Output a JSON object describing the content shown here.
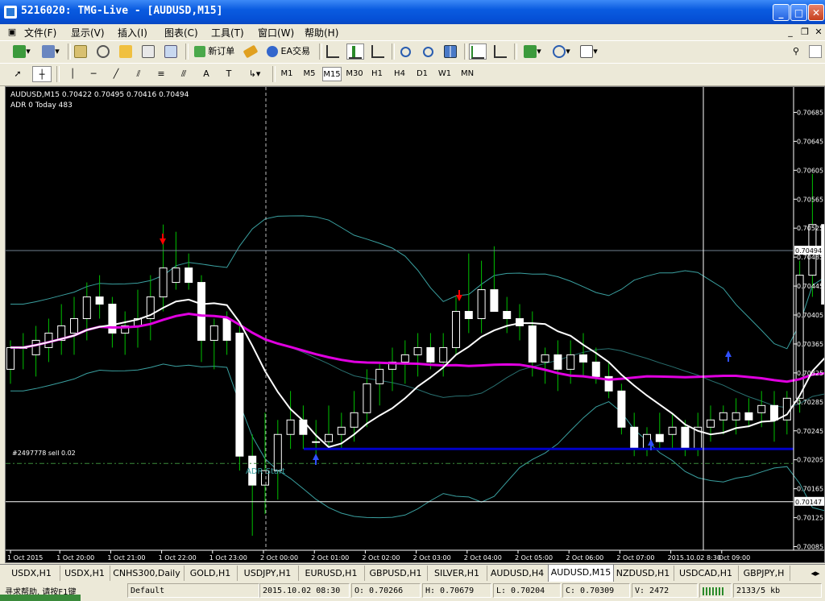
{
  "window": {
    "title": "5216020: TMG-Live - [AUDUSD,M15]"
  },
  "menu": [
    "文件(F)",
    "显示(V)",
    "插入(I)",
    "图表(C)",
    "工具(T)",
    "窗口(W)",
    "帮助(H)"
  ],
  "toolbar": {
    "new_order": "新订单",
    "ea_trading": "EA交易"
  },
  "timeframes": [
    "M1",
    "M5",
    "M15",
    "M30",
    "H1",
    "H4",
    "D1",
    "W1",
    "MN"
  ],
  "active_timeframe": "M15",
  "chart_info": {
    "header": "AUDUSD,M15  0.70422 0.70495 0.70416 0.70494",
    "adr": "ADR 0   Today 483",
    "order_label": "#2497778 sell 0.02",
    "adr_start": "ADR Start"
  },
  "colors": {
    "background": "#000000",
    "candles": "#ffffff",
    "wicks": "#00c000",
    "sma_fast": "#ffffff",
    "sma_slow": "#e000e0",
    "bands": "#3aa0a0",
    "order_line": "#0000c8",
    "sell_arrow": "#ff0000",
    "buy_arrow": "#3050ff",
    "hline": "#708090"
  },
  "chart_data": {
    "type": "candlestick",
    "symbol": "AUDUSD",
    "timeframe": "M15",
    "ylim": [
      0.7008,
      0.7072
    ],
    "price_ticks": [
      "0.70685",
      "0.70645",
      "0.70605",
      "0.70565",
      "0.70525",
      "0.70485",
      "0.70445",
      "0.70405",
      "0.70365",
      "0.70325",
      "0.70285",
      "0.70245",
      "0.70205",
      "0.70165",
      "0.70125",
      "0.70085"
    ],
    "current_price": "0.70494",
    "crosshair_price": "0.70147",
    "time_labels": [
      "1 Oct 2015",
      "1 Oct 20:00",
      "1 Oct 21:00",
      "1 Oct 22:00",
      "1 Oct 23:00",
      "2 Oct 00:00",
      "2 Oct 01:00",
      "2 Oct 02:00",
      "2 Oct 03:00",
      "2 Oct 04:00",
      "2 Oct 05:00",
      "2 Oct 06:00",
      "2 Oct 07:00",
      "2015.10.02 8:30",
      "Oct 09:00"
    ],
    "candles": [
      [
        0.7033,
        0.7037,
        0.7031,
        0.7036
      ],
      [
        0.7036,
        0.7038,
        0.7033,
        0.7036
      ],
      [
        0.7035,
        0.7039,
        0.7032,
        0.7037
      ],
      [
        0.7036,
        0.704,
        0.7034,
        0.7038
      ],
      [
        0.7037,
        0.7042,
        0.7035,
        0.7039
      ],
      [
        0.7038,
        0.7043,
        0.7035,
        0.704
      ],
      [
        0.704,
        0.7045,
        0.7037,
        0.7043
      ],
      [
        0.7043,
        0.7046,
        0.704,
        0.7042
      ],
      [
        0.7042,
        0.7043,
        0.7036,
        0.7038
      ],
      [
        0.7038,
        0.7041,
        0.7035,
        0.7039
      ],
      [
        0.7039,
        0.7044,
        0.7036,
        0.704
      ],
      [
        0.704,
        0.7046,
        0.7037,
        0.7043
      ],
      [
        0.7043,
        0.7053,
        0.7041,
        0.7047
      ],
      [
        0.7045,
        0.7052,
        0.7044,
        0.7047
      ],
      [
        0.7047,
        0.7049,
        0.7044,
        0.7045
      ],
      [
        0.7045,
        0.7046,
        0.7034,
        0.7037
      ],
      [
        0.7037,
        0.704,
        0.7033,
        0.7039
      ],
      [
        0.704,
        0.7041,
        0.7035,
        0.7037
      ],
      [
        0.7038,
        0.7039,
        0.7019,
        0.7021
      ],
      [
        0.7021,
        0.7024,
        0.701,
        0.7017
      ],
      [
        0.7017,
        0.7027,
        0.7013,
        0.7019
      ],
      [
        0.7019,
        0.7026,
        0.7015,
        0.7024
      ],
      [
        0.7024,
        0.703,
        0.7022,
        0.7026
      ],
      [
        0.7026,
        0.7028,
        0.7022,
        0.7024
      ],
      [
        0.7023,
        0.7026,
        0.7021,
        0.7023
      ],
      [
        0.7023,
        0.7028,
        0.7022,
        0.7024
      ],
      [
        0.7024,
        0.7027,
        0.7022,
        0.7025
      ],
      [
        0.7025,
        0.703,
        0.7023,
        0.7027
      ],
      [
        0.7027,
        0.7033,
        0.7025,
        0.7031
      ],
      [
        0.7031,
        0.7034,
        0.7028,
        0.7033
      ],
      [
        0.7033,
        0.7036,
        0.703,
        0.7034
      ],
      [
        0.7034,
        0.7037,
        0.7031,
        0.7035
      ],
      [
        0.7035,
        0.7038,
        0.7032,
        0.7036
      ],
      [
        0.7036,
        0.7038,
        0.7033,
        0.7034
      ],
      [
        0.7034,
        0.7038,
        0.7032,
        0.7036
      ],
      [
        0.7036,
        0.7043,
        0.7035,
        0.7041
      ],
      [
        0.7041,
        0.7049,
        0.7038,
        0.704
      ],
      [
        0.704,
        0.7048,
        0.7038,
        0.7044
      ],
      [
        0.7044,
        0.705,
        0.7041,
        0.7041
      ],
      [
        0.7041,
        0.7043,
        0.7038,
        0.704
      ],
      [
        0.704,
        0.7042,
        0.7037,
        0.7039
      ],
      [
        0.7039,
        0.7041,
        0.7032,
        0.7034
      ],
      [
        0.7034,
        0.7036,
        0.7031,
        0.7035
      ],
      [
        0.7035,
        0.7037,
        0.703,
        0.7033
      ],
      [
        0.7033,
        0.7037,
        0.7031,
        0.7035
      ],
      [
        0.7035,
        0.7038,
        0.7032,
        0.7034
      ],
      [
        0.7034,
        0.7036,
        0.7031,
        0.7032
      ],
      [
        0.7032,
        0.7034,
        0.7029,
        0.703
      ],
      [
        0.703,
        0.7031,
        0.7024,
        0.7025
      ],
      [
        0.7025,
        0.7027,
        0.7021,
        0.7022
      ],
      [
        0.7022,
        0.7025,
        0.7021,
        0.7024
      ],
      [
        0.7024,
        0.7027,
        0.7022,
        0.7023
      ],
      [
        0.7024,
        0.7027,
        0.7022,
        0.7025
      ],
      [
        0.7025,
        0.7026,
        0.7021,
        0.7022
      ],
      [
        0.7022,
        0.7027,
        0.7021,
        0.7025
      ],
      [
        0.7025,
        0.7028,
        0.7023,
        0.7026
      ],
      [
        0.7026,
        0.7028,
        0.7024,
        0.7027
      ],
      [
        0.7026,
        0.7029,
        0.7024,
        0.7027
      ],
      [
        0.7027,
        0.7029,
        0.7025,
        0.7026
      ],
      [
        0.7027,
        0.703,
        0.7025,
        0.7028
      ],
      [
        0.7028,
        0.703,
        0.7023,
        0.7026
      ],
      [
        0.7026,
        0.703,
        0.7024,
        0.7029
      ],
      [
        0.7029,
        0.7048,
        0.7027,
        0.7046
      ],
      [
        0.7046,
        0.706,
        0.7043,
        0.7053
      ],
      [
        0.7053,
        0.7057,
        0.7039,
        0.7042
      ],
      [
        0.7042,
        0.705,
        0.7041,
        0.7049
      ]
    ]
  },
  "symbol_tabs": [
    "USDX,H1",
    "USDX,H1",
    "CNHS300,Daily",
    "GOLD,H1",
    "USDJPY,H1",
    "EURUSD,H1",
    "GBPUSD,H1",
    "SILVER,H1",
    "AUDUSD,H4",
    "AUDUSD,M15",
    "NZDUSD,H1",
    "USDCAD,H1",
    "GBPJPY,H"
  ],
  "active_tab": "AUDUSD,M15",
  "statusbar": {
    "help": "寻求帮助, 请按F1键",
    "profile": "Default",
    "time": "2015.10.02 08:30",
    "open": "O: 0.70266",
    "high": "H: 0.70679",
    "low": "L: 0.70204",
    "close": "C: 0.70309",
    "volume": "V: 2472",
    "traffic": "2133/5 kb"
  }
}
